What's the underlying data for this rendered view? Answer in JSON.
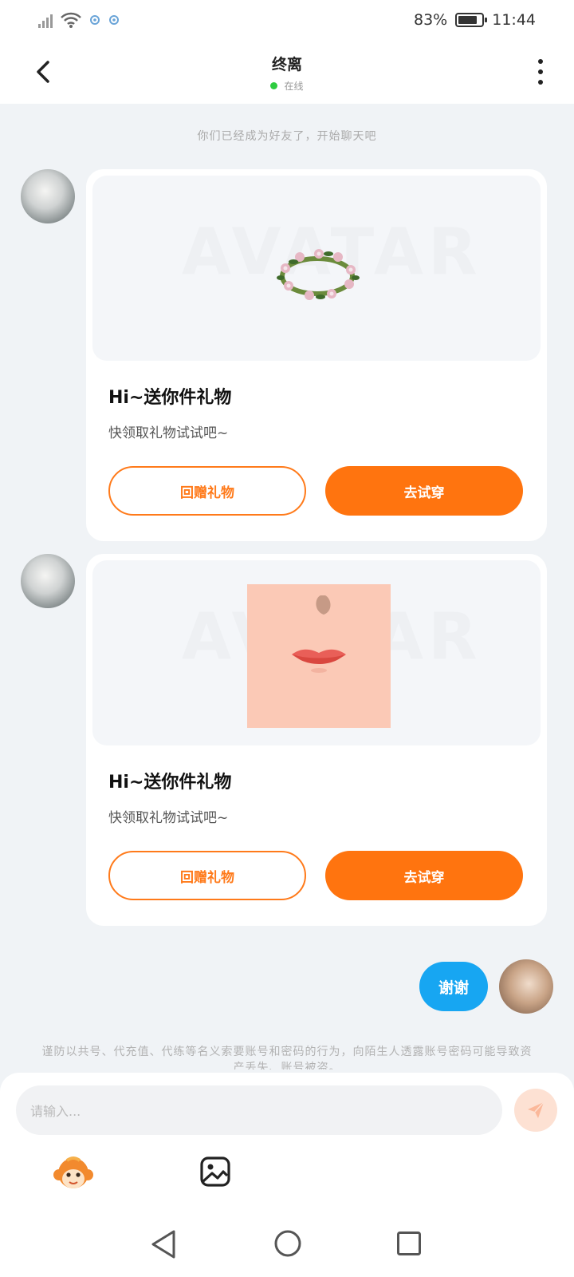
{
  "status_bar": {
    "battery": "83%",
    "time": "11:44",
    "battery_level": 0.83,
    "icons": [
      "signal-icon",
      "wifi-icon",
      "location-icon",
      "location-icon"
    ]
  },
  "header": {
    "title": "终离",
    "status": "在线",
    "status_color": "#2ecc40"
  },
  "chat": {
    "system_notice": "你们已经成为好友了，开始聊天吧",
    "cards": [
      {
        "title": "Hi~送你件礼物",
        "subtitle": "快领取礼物试试吧~",
        "watermark": "AVATAR",
        "reply_button": "回赠礼物",
        "try_button": "去试穿",
        "item": "flower-wreath"
      },
      {
        "title": "Hi~送你件礼物",
        "subtitle": "快领取礼物试试吧~",
        "watermark": "AVATAR",
        "reply_button": "回赠礼物",
        "try_button": "去试穿",
        "item": "lips"
      }
    ],
    "my_message": "谢谢",
    "warning": "谨防以共号、代充值、代练等名义索要账号和密码的行为，向陌生人透露账号密码可能导致资产丢失、账号被盗。"
  },
  "input": {
    "placeholder": "请输入..."
  },
  "colors": {
    "accent_orange": "#ff740f",
    "my_bubble": "#17a6f2",
    "send_disabled": "#fde1d3"
  }
}
